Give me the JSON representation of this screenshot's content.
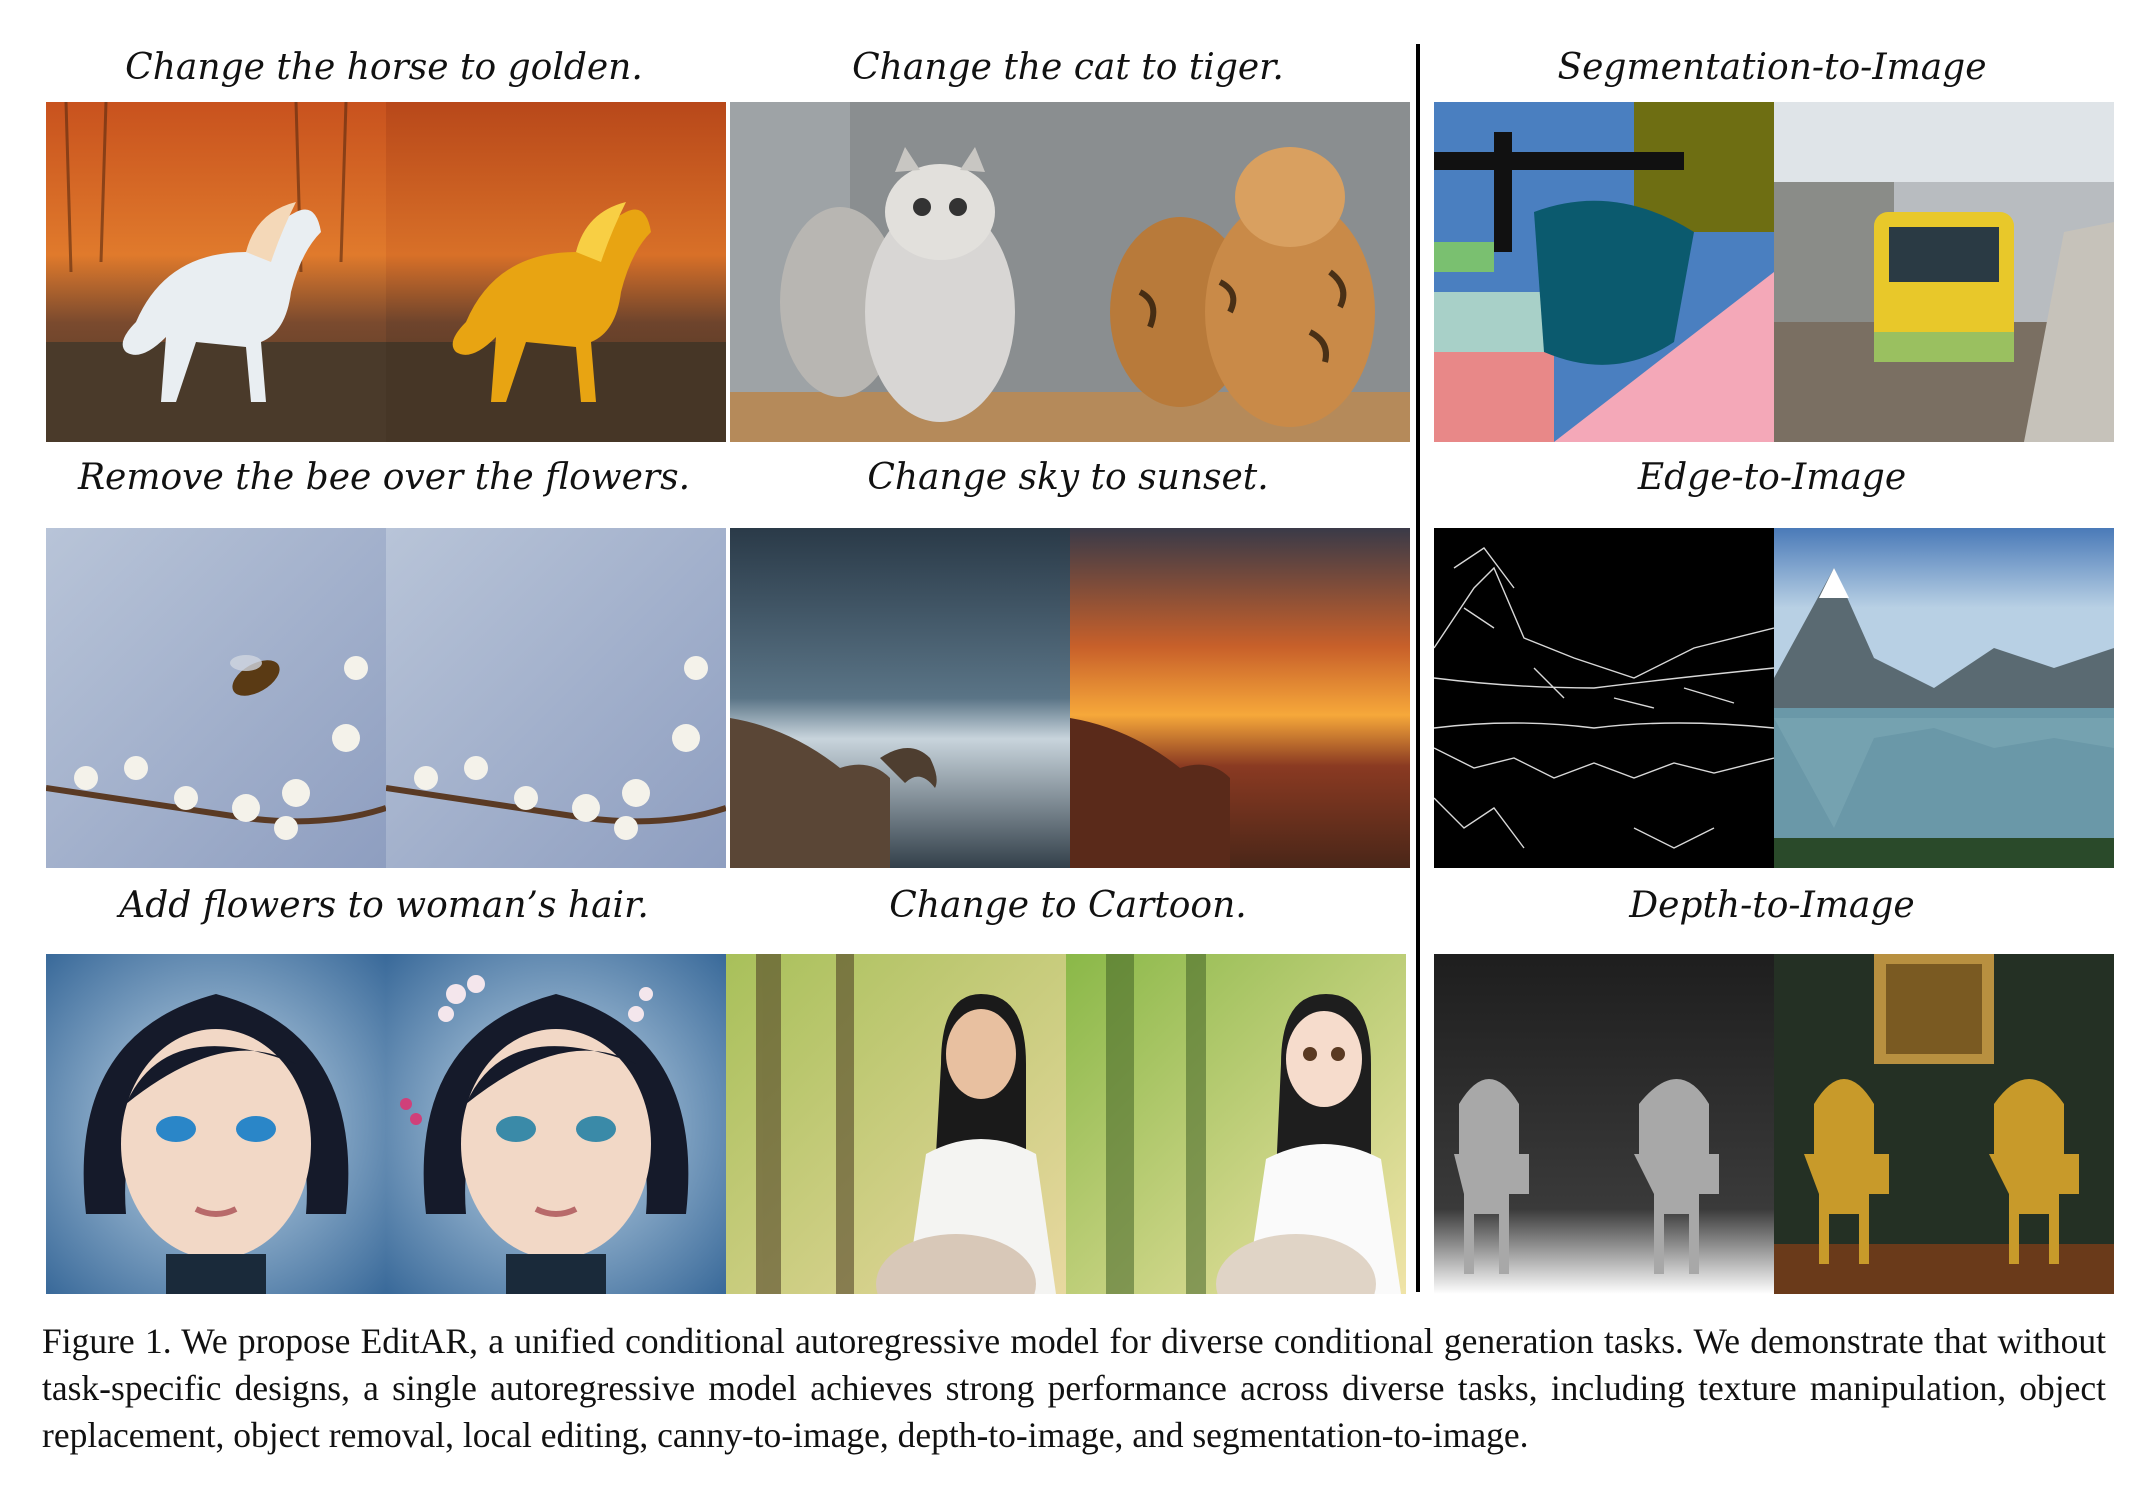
{
  "figure": {
    "panels": [
      {
        "id": "horse",
        "title": "Change the horse to golden.",
        "left_icon": "white-horse-image",
        "right_icon": "golden-horse-image"
      },
      {
        "id": "cat",
        "title": "Change the cat to tiger.",
        "left_icon": "cats-image",
        "right_icon": "tigers-image"
      },
      {
        "id": "seg",
        "title": "Segmentation-to-Image",
        "left_icon": "segmentation-map-image",
        "right_icon": "train-station-image"
      },
      {
        "id": "bee",
        "title": "Remove the bee over the flowers.",
        "left_icon": "bee-flowers-image",
        "right_icon": "flowers-image"
      },
      {
        "id": "sky",
        "title": "Change sky to sunset.",
        "left_icon": "night-sky-coast-image",
        "right_icon": "sunset-coast-image"
      },
      {
        "id": "edge",
        "title": "Edge-to-Image",
        "left_icon": "edge-map-image",
        "right_icon": "mountain-lake-image"
      },
      {
        "id": "hair",
        "title": "Add flowers to woman’s hair.",
        "left_icon": "woman-portrait-image",
        "right_icon": "woman-flowers-image"
      },
      {
        "id": "cartoon",
        "title": "Change to Cartoon.",
        "left_icon": "woman-photo-image",
        "right_icon": "woman-cartoon-image"
      },
      {
        "id": "depth",
        "title": "Depth-to-Image",
        "left_icon": "depth-map-image",
        "right_icon": "golden-chairs-image"
      }
    ]
  },
  "caption": "Figure 1.   We propose EditAR, a unified conditional autoregressive model for diverse conditional generation tasks. We demonstrate that without task-specific designs, a single autoregressive model achieves strong performance across diverse tasks, including texture manipulation, object replacement, object removal, local editing, canny-to-image, depth-to-image, and segmentation-to-image."
}
